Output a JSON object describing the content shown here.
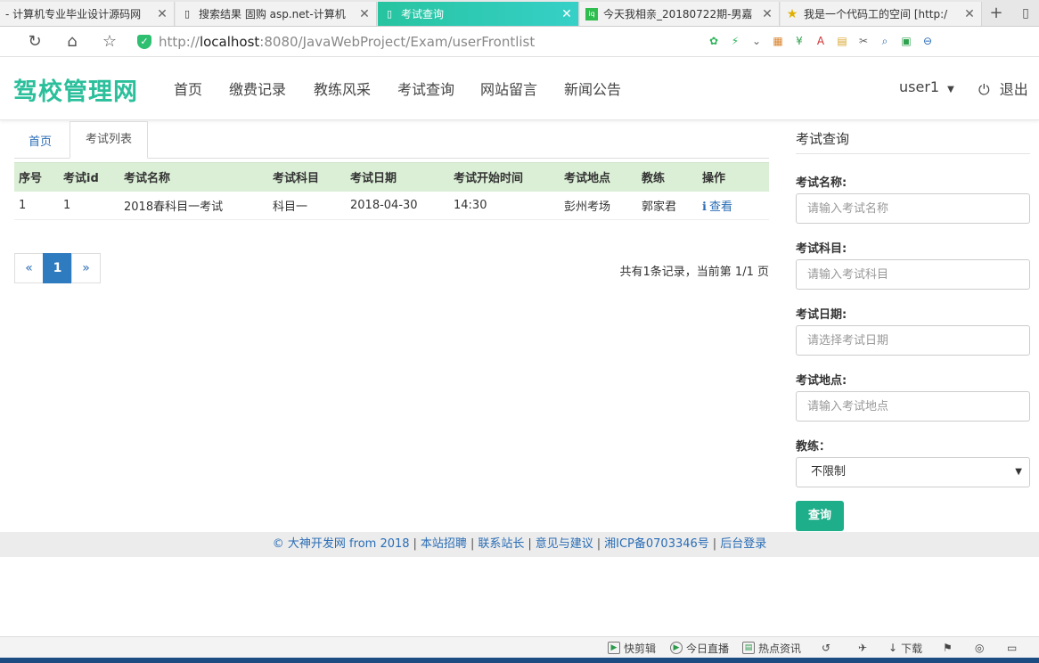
{
  "browser": {
    "tabs": [
      {
        "title": "- 计算机专业毕业设计源码网",
        "icon": "page-icon"
      },
      {
        "title": "搜索结果 固购 asp.net-计算机",
        "icon": "page-icon"
      },
      {
        "title": "考试查询",
        "icon": "page-icon",
        "active": true
      },
      {
        "title": "今天我相亲_20180722期-男嘉",
        "icon": "iqiyi-icon"
      },
      {
        "title": "我是一个代码工的空间 [http:/",
        "icon": "star-icon"
      }
    ],
    "url": {
      "scheme": "http://",
      "host": "localhost",
      "rest": ":8080/JavaWebProject/Exam/userFrontlist"
    }
  },
  "site": {
    "logo": "驾校管理网",
    "nav": [
      "首页",
      "缴费记录",
      "教练风采",
      "考试查询",
      "网站留言",
      "新闻公告"
    ],
    "user": "user1",
    "logout": "退出"
  },
  "breadcrumb": {
    "home": "首页",
    "current": "考试列表"
  },
  "table": {
    "columns": [
      "序号",
      "考试id",
      "考试名称",
      "考试科目",
      "考试日期",
      "考试开始时间",
      "考试地点",
      "教练",
      "操作"
    ],
    "rows": [
      [
        "1",
        "1",
        "2018春科目一考试",
        "科目一",
        "2018-04-30",
        "14:30",
        "彭州考场",
        "郭家君",
        "查看"
      ]
    ]
  },
  "pagination": {
    "prev": "«",
    "current": "1",
    "next": "»",
    "info": "共有1条记录，当前第 1/1 页"
  },
  "search": {
    "title": "考试查询",
    "fields": [
      {
        "label": "考试名称:",
        "placeholder": "请输入考试名称"
      },
      {
        "label": "考试科目:",
        "placeholder": "请输入考试科目"
      },
      {
        "label": "考试日期:",
        "placeholder": "请选择考试日期"
      },
      {
        "label": "考试地点:",
        "placeholder": "请输入考试地点"
      }
    ],
    "coach_label": "教练：",
    "coach_selected": "不限制",
    "button": "查询"
  },
  "footer": {
    "links": [
      "© 大神开发网 from 2018",
      "本站招聘",
      "联系站长",
      "意见与建议",
      "湘ICP备0703346号",
      "后台登录"
    ]
  },
  "statusbar": {
    "items": [
      "快剪辑",
      "今日直播",
      "热点资讯",
      "下载"
    ]
  },
  "colors": {
    "brand": "#2bbf9b",
    "table_header": "#dbefd6",
    "link": "#2a6db5",
    "button": "#1fae8a"
  }
}
